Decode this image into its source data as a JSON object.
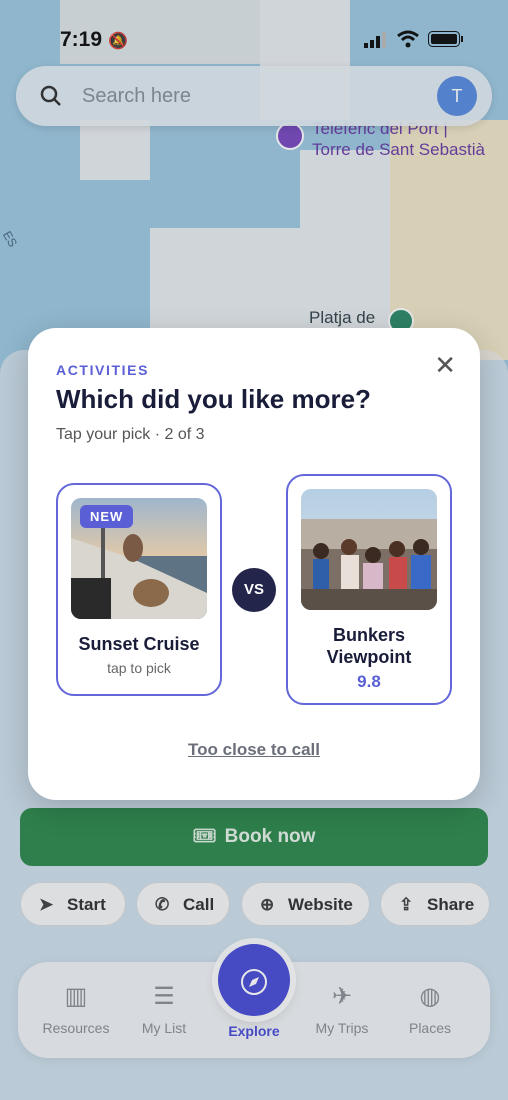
{
  "status": {
    "time": "7:19"
  },
  "map": {
    "labels": [
      "Telefèric del Port |",
      "Torre de Sant Sebastià",
      "Platja de"
    ],
    "road_label": "ES"
  },
  "search": {
    "placeholder": "Search here",
    "avatar_initial": "T"
  },
  "actions": {
    "book_now": "Book now",
    "start": "Start",
    "call": "Call",
    "website": "Website",
    "share": "Share"
  },
  "tabs": [
    {
      "label": "Resources",
      "icon": "books-icon"
    },
    {
      "label": "My List",
      "icon": "list-icon"
    },
    {
      "label": "Explore",
      "icon": "compass-icon"
    },
    {
      "label": "My Trips",
      "icon": "plane-icon"
    },
    {
      "label": "Places",
      "icon": "globe-icon"
    }
  ],
  "modal": {
    "eyebrow": "ACTIVITIES",
    "title": "Which did you like more?",
    "subtitle": "Tap your pick · 2 of 3",
    "vs": "VS",
    "too_close": "Too close to call",
    "left": {
      "badge": "NEW",
      "title": "Sunset Cruise",
      "hint": "tap to pick"
    },
    "right": {
      "title_line1": "Bunkers",
      "title_line2": "Viewpoint",
      "score": "9.8"
    }
  },
  "colors": {
    "accent": "#5a5fd6",
    "book": "#2f8a4e",
    "vs_bg": "#23254a"
  }
}
